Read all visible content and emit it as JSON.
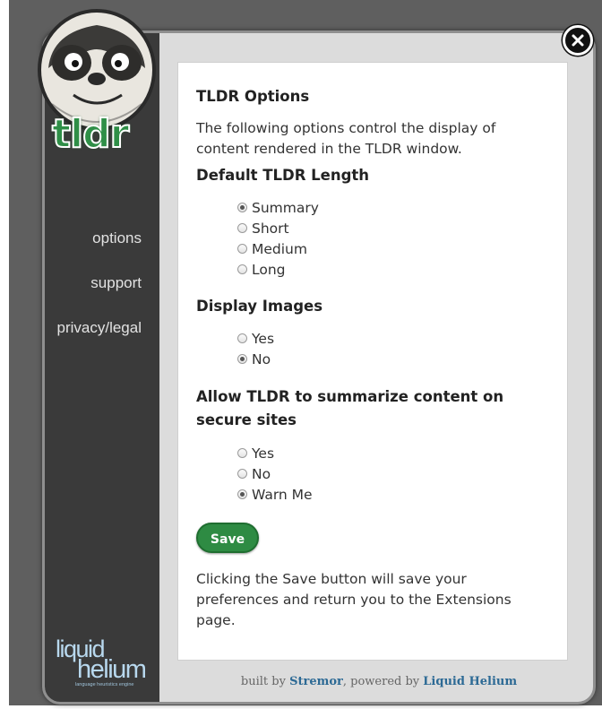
{
  "sidebar": {
    "items": [
      {
        "label": "options"
      },
      {
        "label": "support"
      },
      {
        "label": "privacy/legal"
      }
    ],
    "brand": {
      "word1": "liquid",
      "word2": "helium",
      "tagline": "language heuristics engine"
    }
  },
  "mascot": {
    "logo_text": "tldr"
  },
  "content": {
    "title": "TLDR Options",
    "intro": "The following options control the display of content rendered in the TLDR window.",
    "length": {
      "heading": "Default TLDR Length",
      "options": [
        "Summary",
        "Short",
        "Medium",
        "Long"
      ],
      "selected": "Summary"
    },
    "images": {
      "heading": "Display Images",
      "options": [
        "Yes",
        "No"
      ],
      "selected": "No"
    },
    "secure": {
      "heading": "Allow TLDR to summarize content on secure sites",
      "options": [
        "Yes",
        "No",
        "Warn Me"
      ],
      "selected": "Warn Me"
    },
    "save_label": "Save",
    "save_note": "Clicking the Save button will save your preferences and return you to the Extensions page."
  },
  "footer": {
    "prefix": "built by ",
    "stremor": "Stremor",
    "middle": ", powered by ",
    "liquid_helium": "Liquid Helium"
  },
  "colors": {
    "accent_green": "#2e8b43",
    "sidebar_bg": "#3a3a3a",
    "link_blue": "#2d6a95"
  }
}
